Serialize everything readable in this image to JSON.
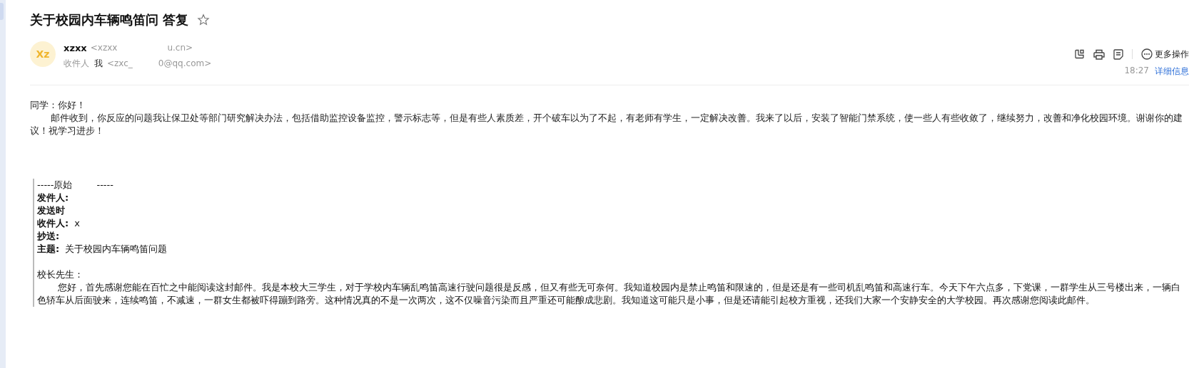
{
  "mail": {
    "title": "关于校园内车辆鸣笛问 答复",
    "starred": false,
    "sender": {
      "avatar": "Xz",
      "name": "xzxx",
      "address_start": "<xzxx",
      "address_end": "u.cn>"
    },
    "recipient": {
      "label": "收件人",
      "name": "我",
      "address_start": "<zxc_",
      "address_end": "0@qq.com>"
    },
    "time": "18:27",
    "more_label": "更多操作",
    "details_link": "详细信息"
  },
  "body": [
    "同学：你好！",
    "邮件收到，你反应的问题我让保卫处等部门研究解决办法，包括借助监控设备监控，警示标志等，但是有些人素质差，开个破车以为了不起，有老师有学生，一定解决改善。我来了以后，安装了智能门禁系统，使一些人有些收敛了，继续努力，改善和净化校园环境。谢谢你的建议！祝学习进步！"
  ],
  "quoted": {
    "separator_start": "-----原始",
    "separator_end": "-----",
    "headers": [
      {
        "label": "发件人:"
      },
      {
        "label": "发送时"
      },
      {
        "label": "收件人:",
        "value": "x"
      },
      {
        "label": "抄送:"
      },
      {
        "label": "主题:",
        "value": "关于校园内车辆鸣笛问题"
      }
    ],
    "salutation": "校长先生：",
    "paragraph": "您好，首先感谢您能在百忙之中能阅读这封邮件。我是本校大三学生，对于学校内车辆乱鸣笛高速行驶问题很是反感，但又有些无可奈何。我知道校园内是禁止鸣笛和限速的，但是还是有一些司机乱鸣笛和高速行车。今天下午六点多，下党课，一群学生从三号楼出来，一辆白色轿车从后面驶来，连续鸣笛，不减速，一群女生都被吓得蹦到路旁。这种情况真的不是一次两次，这不仅噪音污染而且严重还可能酿成悲剧。我知道这可能只是小事，但是还请能引起校方重视，还我们大家一个安静安全的大学校园。再次感谢您阅读此邮件。"
  }
}
